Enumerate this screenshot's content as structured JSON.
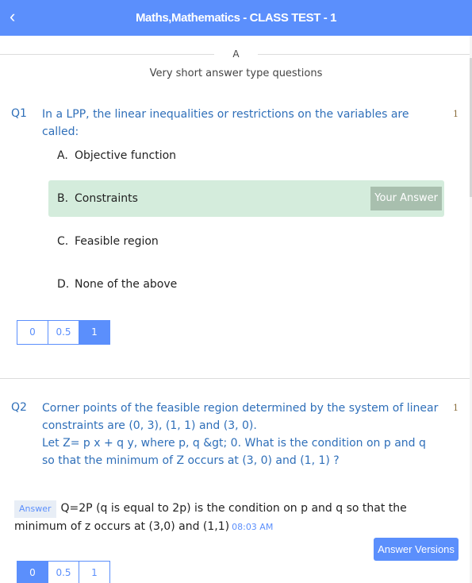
{
  "header": {
    "back_icon": "chevron-left-icon",
    "back_glyph": "‹",
    "title": "Maths,Mathematics - CLASS TEST - 1"
  },
  "section": {
    "letter": "A",
    "description": "Very short answer type questions"
  },
  "questions": [
    {
      "number": "Q1",
      "text": "In a LPP, the linear inequalities or restrictions on the variables are called:",
      "marks": "1",
      "options": [
        {
          "letter": "A.",
          "text": "Objective function",
          "selected": false
        },
        {
          "letter": "B.",
          "text": "Constraints",
          "selected": true
        },
        {
          "letter": "C.",
          "text": "Feasible region",
          "selected": false
        },
        {
          "letter": "D.",
          "text": "None of the above",
          "selected": false
        }
      ],
      "your_answer_label": "Your Answer",
      "scores": [
        "0",
        "0.5",
        "1"
      ],
      "selected_score": "1"
    },
    {
      "number": "Q2",
      "text_lines": [
        "Corner points of the feasible region determined by the system of linear",
        "constraints are (0, 3), (1, 1) and (3, 0).",
        "Let  Z= p x + q y,  where p, q &gt; 0. What is the condition on p and q",
        "so that the minimum of Z occurs at (3, 0) and (1, 1) ?"
      ],
      "marks": "1",
      "answer_tag": "Answer",
      "answer_text": "Q=2P (q is equal to 2p) is the condition on p and q so that the minimum of z occurs at (3,0) and (1,1)",
      "answer_time": "08:03 AM",
      "answer_versions_label": "Answer Versions",
      "scores": [
        "0",
        "0.5",
        "1"
      ],
      "selected_score": "0"
    }
  ],
  "colors": {
    "accent": "#5b8ffc",
    "question_text": "#2f6fb9",
    "selected_option_bg": "#d4ecdc",
    "your_answer_bg": "#a8bfae"
  }
}
